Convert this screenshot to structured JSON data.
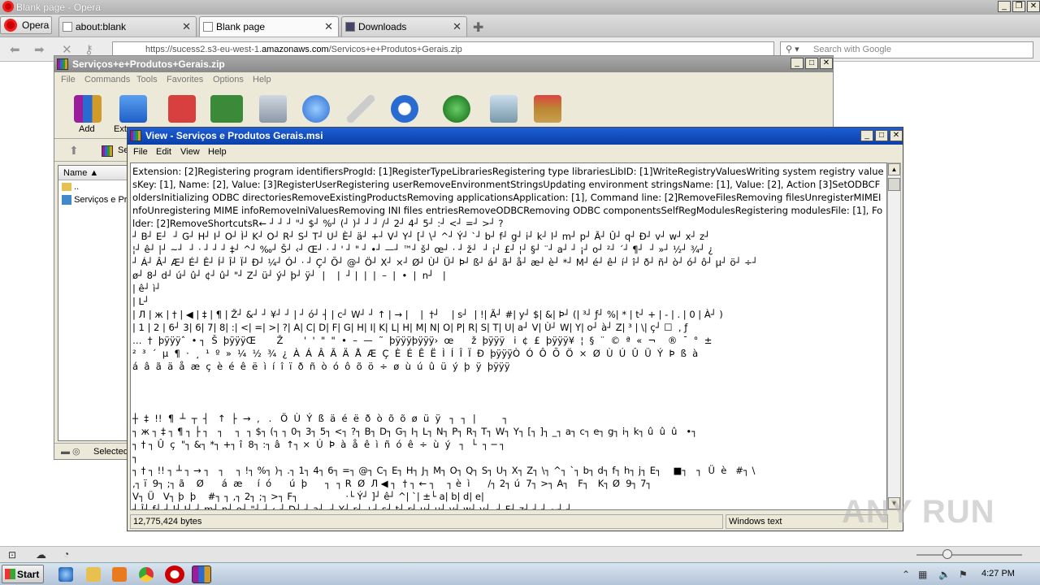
{
  "browser": {
    "title": "Blank page - Opera",
    "menu_label": "Opera",
    "tabs": [
      {
        "label": "about:blank",
        "active": false
      },
      {
        "label": "Blank page",
        "active": true
      },
      {
        "label": "Downloads",
        "active": false
      }
    ],
    "url_prefix": "https://sucess2.s3-eu-west-1.",
    "url_domain": "amazonaws.com",
    "url_path": "/Servicos+e+Produtos+Gerais.zip",
    "search_placeholder": "Search with Google"
  },
  "winrar": {
    "title": "Serviços+e+Produtos+Gerais.zip",
    "menu": [
      "File",
      "Commands",
      "Tools",
      "Favorites",
      "Options",
      "Help"
    ],
    "toolbar": [
      "Add",
      "Ext"
    ],
    "path_text": "Se",
    "column_name": "Name",
    "files": [
      "..",
      "Serviços e Pr"
    ],
    "status_text": "Selected"
  },
  "viewer": {
    "title": "View - Serviços e Produtos Gerais.msi",
    "menu": [
      "File",
      "Edit",
      "View",
      "Help"
    ],
    "content": "Extension: [2]Registering program identifiersProgId: [1]RegisterTypeLibrariesRegistering type librariesLibID: [1]WriteRegistryValuesWriting system registry valuesKey: [1], Name: [2], Value: [3]RegisterUserRegistering userRemoveEnvironmentStringsUpdating environment stringsName: [1], Value: [2], Action [3]SetODBCFoldersInitializing ODBC directoriesRemoveExistingProductsRemoving applicationsApplication: [1], Command line: [2]RemoveFilesRemoving filesUnregisterMIMEInfoUnregistering MIME infoRemoveIniValuesRemoving INI files entriesRemoveODBCRemoving ODBC componentsSelfRegModulesRegistering modulesFile: [1], Folder: [2]RemoveShortcutsR← ┘ ┘ ┘ \"┘ $┘ %┘ (┘ )┘ ┘ ┘ /┘ 2┘ 4┘ 5┘ :┘ <┘ =┘ >┘ ?\n┘ B┘ E┘  ┘ G┘ H┘ I┘ O┘ Ì┘ K┘ O┘ R┘ S┘ T┘ U┘ È┘ ä┘ +┘ V┘ Y┘ [┘ \\┘ ^┘ Ý┘ `┘ b┘ f┘ g┘ i┘ k┘ l┘ m┘ p┘ Ã┘ Û┘ q┘ Ð┘ v┘ w┘ x┘ z┘\n¦┘ ê┘ |┘ ~┘  ┘ · ┘ ┘ ┘ ‡┘ ^┘ ‰┘ Š┘ ‹┘ Œ┘ · ┘ ' ┘ \" ┘ •┘ —┘ ™┘ š┘ œ┘ · ┘ ž┘  ┘ ¡┘ £┘ ¦┘ §┘ ¨┘ a┘ ┘ ¡┘ o┘ ²┘ ´┘ ¶┘  ┘ »┘ ½┘ ¾┘ ¿\n┘ Á┘ Â┘ Æ┘ É┘ Ê┘ Í┘ Î┘ Ï┘ Ð┘ ¼┘ Ó┘ · ┘ Ç┘ Õ┘ @┘ Ö┘ X┘ ×┘ Ø┘ Ù┘ Ü┘ Þ┘ ß┘ á┘ ã┘ å┘ æ┘ è┘ *┘ M┘ é┘ ê┘ í┘ î┘ ð┘ ñ┘ ò┘ ó┘ ô┘ µ┘ ö┘ ÷┘\nø┘ 8┘ d┘ ú┘ û┘ ¢┘ û┘ \"┘ Z┘ ü┘ ý┘ þ┘ ÿ┘  |    |  ┘ |  |  |  –  |  •  |  n┘   |\n| ê┘ ì┘\n| L┘\n| Л | ж | † | ◀ | ‡ | ¶ | Ž┘ &┘ ┘ ¥┘ ┘ | ┘ ó┘ ┤ | c┘ W┘ ┘ ↑ | → |    |  †┘    | s┘  | !| Ã┘ #| y┘ $| &| Þ┘ (| ³┘ ƒ┘ %| * | t┘ + | - | . | 0 | À┘ )\n| 1 | 2 | 6┘ 3| 6| 7| 8| :| <| =| >| ?| A| C| D| F| G| H| I| K| L| H| M| N| O| P| R| S| T| U| a┘ V| Ù┘ W| Y| o┘ à┘ Z| ³ | \\| ç┘ ☐  , ƒ  \n…  †  þÿÿÿˆ  • ┐  Š  þÿÿÿŒ       Ž       '  '  \"  \"  •  –  —  ˜  þÿÿÿþÿÿÿ›  œ      ž  þÿÿÿ   i  ¢  £  þÿÿÿ¥  ¦  §  ¨  ©  ª  «  ¬    ®  ¯  °  ±\n²  ³  ´  µ  ¶  ·  ¸  ¹  º  »  ¼  ½  ¾  ¿  À  Á  Â  Ã  Ä  Å  Æ  Ç  È  É  Ê  Ë  Ì  Í  Î  Ï  Ð  þÿÿÿÒ  Ó  Ô  Õ  Ö  ×  Ø  Ù  Ú  Û  Ü  Ý  Þ  ß  à\ná  â  ã  ä  å  æ  ç  è  é  ê  ë  ì  í  î  ï  ð  ñ  ò  ó  ô  õ  ö  ÷  ø  ù  ú  û  ü  ý  þ  ÿ  þÿÿÿ\n\n\n\n┼  ‡  !!  ¶  ┴  ┬  ┤   ↑  ├  →  ,   .   Ö  Ù  Ý  ß  ä  é  ë  ð  ò  õ  õ  ø  ü  ÿ   ┐  ┐  |         ┐\n┐ ж ┐ ‡ ┐ ¶ ┐ ├ ┐   ┐    ┐  ┐ $┐ (┐ ┐ 0┐ 3┐ 5┐ <┐ ?┐ B┐ D┐ G┐ I┐ L┐ N┐ P┐ R┐ T┐ W┐ Y┐ [┐ ]┐ _┐ a┐ c┐ e┐ g┐ i┐ k┐ û  û  û   •┐\n┐ † ┐ Û  ç  \"┐ &┐ *┐ +┐ î  8┐ :┐ â  ↑┐ ×  Ú  Þ  à  å  ê  ì  ñ  ó  ê  ÷  ù  ý   ┐  └  ┐ ─ ┐\n┐\n┐ † ┐ !! ┐ ┴ ┐ → ┐   ┐    ┐ !┐ %┐ )┐ .┐ 1┐ 4┐ 6┐ =┐ @┐ C┐ E┐ H┐ J┐ M┐ O┐ Q┐ S┐ U┐ X┐ Z┐ \\┐ ^┐ `┐ b┐ d┐ f┐ h┐ j┐ E┐    ■┐   ┐  Ü  è   #┐ \\\n,┐ ï  9┐ ;┐ ã    Ø      á  æ     í  ó      ú  þ      ┐  ┐ R  Ø  Л ◀ ┐  † ┐ ← ┐    ┐ è  ì      /┐ 2┐ ú  7┐ >┐ A┐   F┐   K┐ Ø  9┐ 7┐\nV┐ Ü   V┐ þ  þ    #┐ ┐ ,┐ 2┐ ;┐ >┐ F┐                ·└ Ý┘ ]┘ ê┘ ^| `| ±└ a| b| d| e|\n┘ Î┘ f┘ ┘ l┘ I┘ ┘ m┘ n┘ o┘ \"┘ ┘ ←┘ D┘ ┘ a┘  ┘ Y┘ r┘ +┘ s┘ t┘ r┘ u┘ u┘ v┘ w┘ v┘  ┘ F┘ z┘ ┘ ┘ ~┘ ┘",
    "status_size": "12,775,424 bytes",
    "status_mode": "Windows text"
  },
  "taskbar": {
    "start_label": "Start",
    "clock": "4:27 PM"
  },
  "watermark": "ANY RUN"
}
